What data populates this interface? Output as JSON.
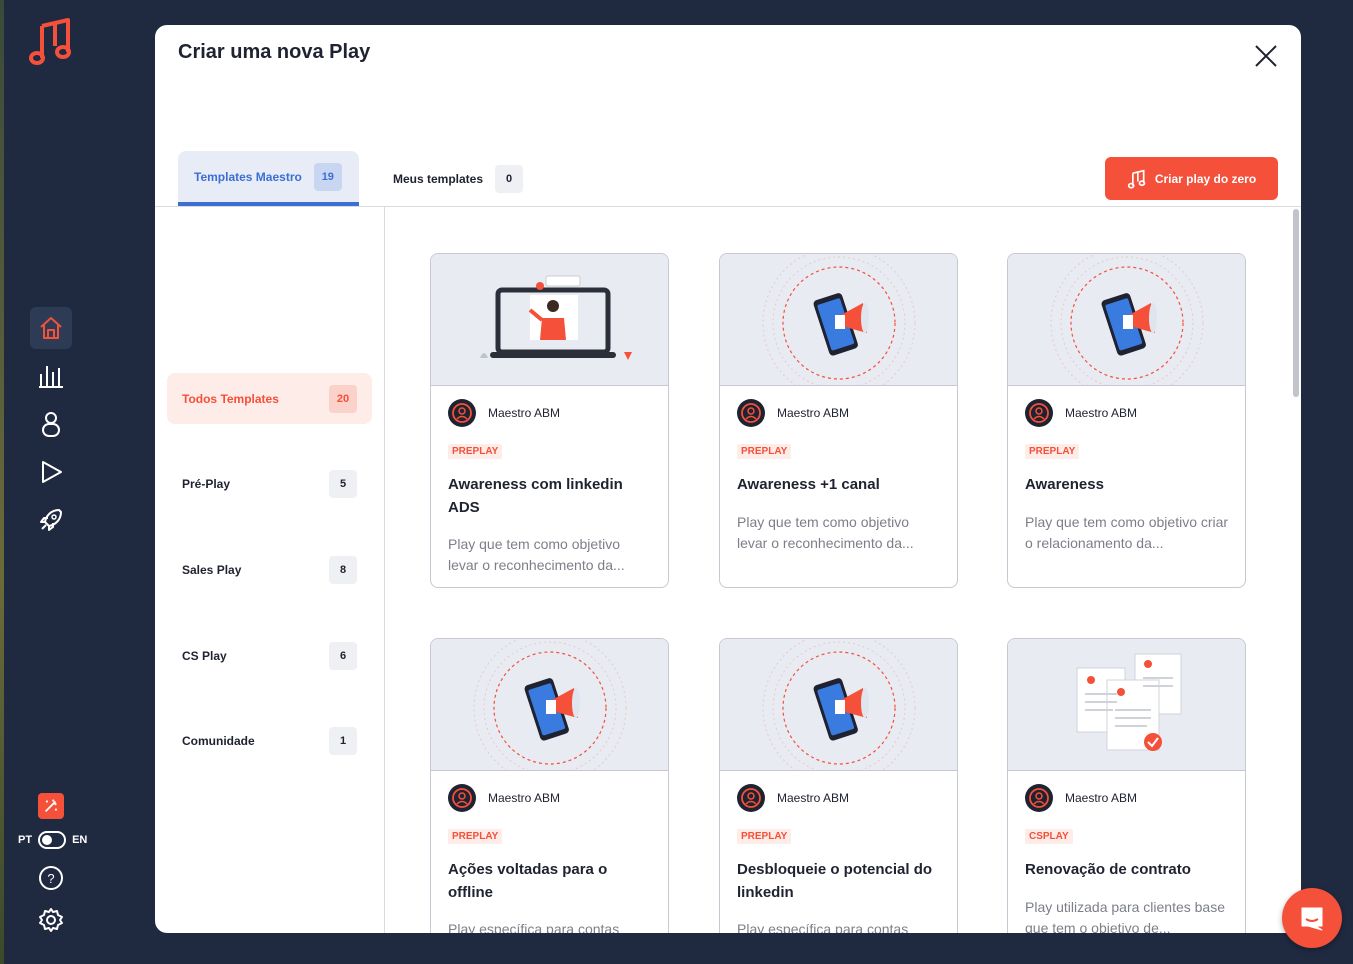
{
  "modal": {
    "title": "Criar uma nova Play",
    "tabs": [
      {
        "label": "Templates Maestro",
        "count": "19"
      },
      {
        "label": "Meus templates",
        "count": "0"
      }
    ],
    "create_button": "Criar play do zero"
  },
  "categories": [
    {
      "label": "Todos Templates",
      "count": "20"
    },
    {
      "label": "Pré-Play",
      "count": "5"
    },
    {
      "label": "Sales Play",
      "count": "8"
    },
    {
      "label": "CS Play",
      "count": "6"
    },
    {
      "label": "Comunidade",
      "count": "1"
    }
  ],
  "cards": [
    {
      "author": "Maestro ABM",
      "badge": "PREPLAY",
      "title": "Awareness com linkedin ADS",
      "desc": "Play que tem como objetivo levar o reconhecimento da...",
      "illustration": "laptop-presenter"
    },
    {
      "author": "Maestro ABM",
      "badge": "PREPLAY",
      "title": "Awareness +1 canal",
      "desc": "Play que tem como objetivo levar o reconhecimento da...",
      "illustration": "phone-megaphone"
    },
    {
      "author": "Maestro ABM",
      "badge": "PREPLAY",
      "title": "Awareness",
      "desc": "Play que tem como objetivo criar o relacionamento da...",
      "illustration": "phone-megaphone"
    },
    {
      "author": "Maestro ABM",
      "badge": "PREPLAY",
      "title": "Ações voltadas para o offline",
      "desc": "Play específica para contas",
      "illustration": "phone-megaphone"
    },
    {
      "author": "Maestro ABM",
      "badge": "PREPLAY",
      "title": "Desbloqueie o potencial do linkedin",
      "desc": "Play específica para contas",
      "illustration": "phone-megaphone"
    },
    {
      "author": "Maestro ABM",
      "badge": "CSPLAY",
      "title": "Renovação de contrato",
      "desc": "Play utilizada para clientes base que tem o objetivo de...",
      "illustration": "documents-check"
    }
  ],
  "sidebar": {
    "lang_left": "PT",
    "lang_right": "EN",
    "icons": [
      "home-icon",
      "chart-icon",
      "user-icon",
      "play-icon",
      "rocket-icon"
    ]
  },
  "colors": {
    "accent": "#f4503a",
    "blue": "#3b6fd4",
    "navy": "#1f2940"
  }
}
